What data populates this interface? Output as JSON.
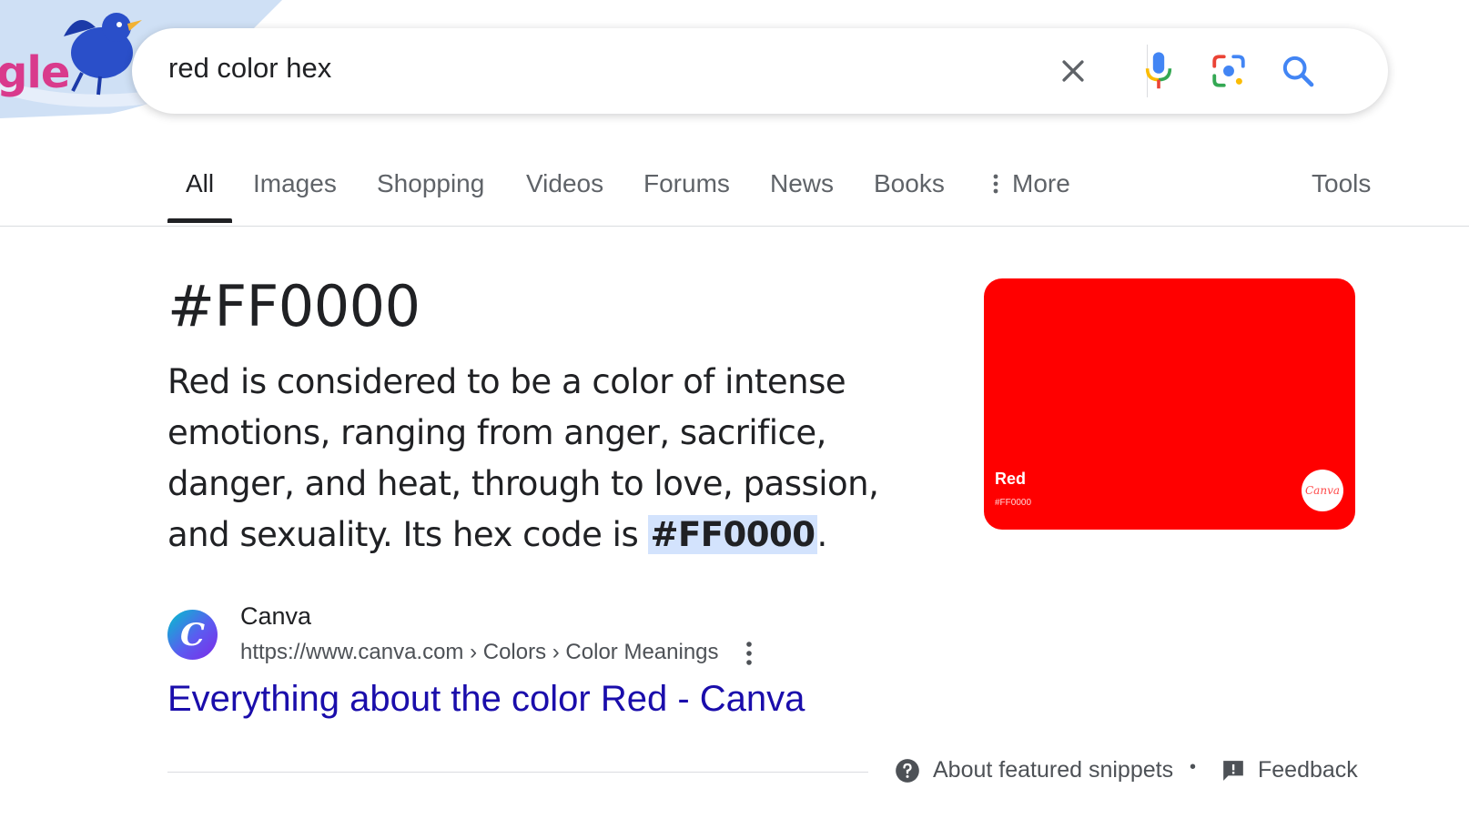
{
  "search": {
    "query": "red color hex",
    "clear_icon": "close-icon",
    "voice_icon": "microphone-icon",
    "lens_icon": "camera-lens-icon",
    "search_icon": "search-icon"
  },
  "doodle": {
    "text": "gle"
  },
  "tabs": [
    {
      "label": "All",
      "active": true
    },
    {
      "label": "Images"
    },
    {
      "label": "Shopping"
    },
    {
      "label": "Videos"
    },
    {
      "label": "Forums"
    },
    {
      "label": "News"
    },
    {
      "label": "Books"
    },
    {
      "label": "More",
      "icon": "vertical-dots-icon"
    },
    {
      "label": "Tools"
    }
  ],
  "snippet": {
    "heading": "#FF0000",
    "description_lead": "Red is considered to be a color of intense emotions, ranging from anger, sacrifice, danger, and heat, through to love, passion, and sexuality. Its hex code is ",
    "description_highlight": "#FF0000",
    "description_tail": ".",
    "image": {
      "color": "#FF0000",
      "label": "Red",
      "hex_label": "#FF0000",
      "logo_text": "Canva"
    },
    "source": {
      "logo_letter": "C",
      "name": "Canva",
      "url": "https://www.canva.com › Colors › Color Meanings"
    },
    "result_title": "Everything about the color Red - Canva"
  },
  "footer": {
    "about": "About featured snippets",
    "about_icon": "help-circle-icon",
    "separator": "•",
    "feedback": "Feedback",
    "feedback_icon": "feedback-icon"
  },
  "colors": {
    "link": "#1a0dab",
    "highlight": "#d3e3fd",
    "swatch": "#ff0000"
  }
}
